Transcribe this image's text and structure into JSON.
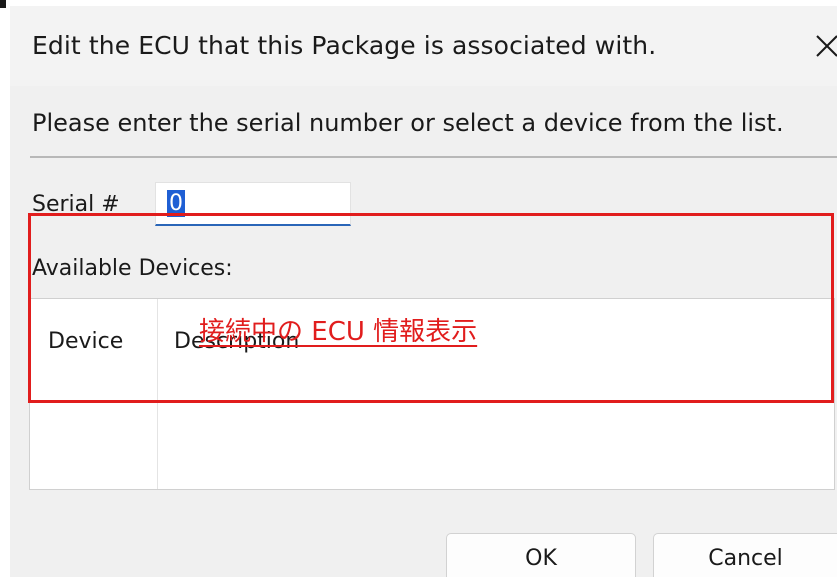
{
  "dialog": {
    "title": "Edit the ECU that this Package is associated with.",
    "close_icon": "close-icon",
    "instruction": "Please enter the serial number or select a device from the list."
  },
  "serial": {
    "label": "Serial #",
    "value": "0"
  },
  "devices": {
    "label": "Available Devices:",
    "columns": [
      "Device",
      "Description"
    ]
  },
  "annotation": {
    "text": "接続中の ECU 情報表示",
    "color": "#e11d1d"
  },
  "buttons": {
    "ok": "OK",
    "cancel": "Cancel"
  },
  "colors": {
    "titlebar": "#f3f3f3",
    "background": "#f0f0f0",
    "selection": "#1f5fd4",
    "input_underline": "#2a66b8",
    "highlight_border": "#e11d1d"
  }
}
